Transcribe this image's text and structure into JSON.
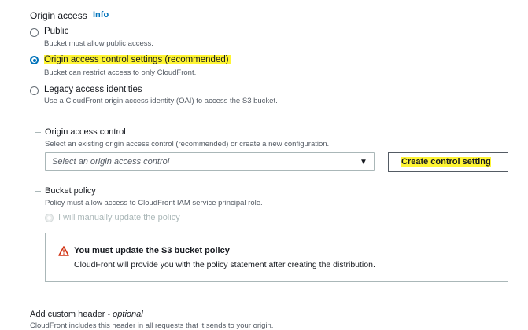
{
  "origin_access": {
    "title": "Origin access",
    "info_link": "Info",
    "options": [
      {
        "label": "Public",
        "description": "Bucket must allow public access.",
        "selected": false
      },
      {
        "label": "Origin access control settings (recommended)",
        "description": "Bucket can restrict access to only CloudFront.",
        "selected": true
      },
      {
        "label": "Legacy access identities",
        "description": "Use a CloudFront origin access identity (OAI) to access the S3 bucket.",
        "selected": false
      }
    ]
  },
  "origin_access_control": {
    "label": "Origin access control",
    "description": "Select an existing origin access control (recommended) or create a new configuration.",
    "select_placeholder": "Select an origin access control",
    "create_button": "Create control setting"
  },
  "bucket_policy": {
    "label": "Bucket policy",
    "description": "Policy must allow access to CloudFront IAM service principal role.",
    "manual_option": "I will manually update the policy"
  },
  "alert": {
    "title": "You must update the S3 bucket policy",
    "body": "CloudFront will provide you with the policy statement after creating the distribution."
  },
  "custom_header": {
    "title": "Add custom header",
    "optional": "optional",
    "separator": " - ",
    "description": "CloudFront includes this header in all requests that it sends to your origin."
  },
  "colors": {
    "link": "#0073bb",
    "highlight": "#fff533",
    "warning": "#d13212"
  }
}
